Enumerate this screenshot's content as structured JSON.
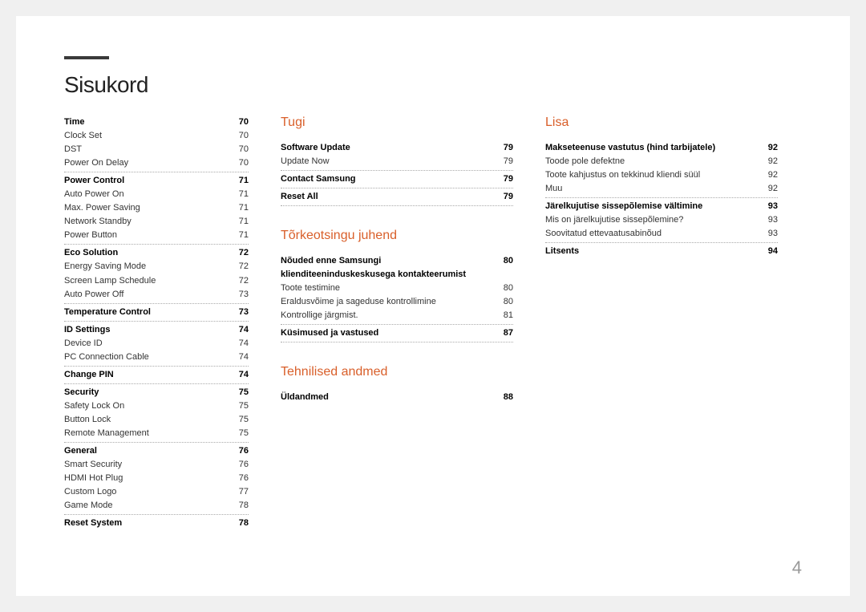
{
  "title": "Sisukord",
  "page_number": "4",
  "col1_groups": [
    [
      {
        "label": "Time",
        "page": "70",
        "bold": true
      },
      {
        "label": "Clock Set",
        "page": "70"
      },
      {
        "label": "DST",
        "page": "70"
      },
      {
        "label": "Power On Delay",
        "page": "70"
      }
    ],
    [
      {
        "label": "Power Control",
        "page": "71",
        "bold": true
      },
      {
        "label": "Auto Power On",
        "page": "71"
      },
      {
        "label": "Max. Power Saving",
        "page": "71"
      },
      {
        "label": "Network Standby",
        "page": "71"
      },
      {
        "label": "Power Button",
        "page": "71"
      }
    ],
    [
      {
        "label": "Eco Solution",
        "page": "72",
        "bold": true
      },
      {
        "label": "Energy Saving Mode",
        "page": "72"
      },
      {
        "label": "Screen Lamp Schedule",
        "page": "72"
      },
      {
        "label": "Auto Power Off",
        "page": "73"
      }
    ],
    [
      {
        "label": "Temperature Control",
        "page": "73",
        "bold": true
      }
    ],
    [
      {
        "label": "ID Settings",
        "page": "74",
        "bold": true
      },
      {
        "label": "Device ID",
        "page": "74"
      },
      {
        "label": "PC Connection Cable",
        "page": "74"
      }
    ],
    [
      {
        "label": "Change PIN",
        "page": "74",
        "bold": true
      }
    ],
    [
      {
        "label": "Security",
        "page": "75",
        "bold": true
      },
      {
        "label": "Safety Lock On",
        "page": "75"
      },
      {
        "label": "Button Lock",
        "page": "75"
      },
      {
        "label": "Remote Management",
        "page": "75"
      }
    ],
    [
      {
        "label": "General",
        "page": "76",
        "bold": true
      },
      {
        "label": "Smart Security",
        "page": "76"
      },
      {
        "label": "HDMI Hot Plug",
        "page": "76"
      },
      {
        "label": "Custom Logo",
        "page": "77"
      },
      {
        "label": "Game Mode",
        "page": "78"
      }
    ],
    [
      {
        "label": "Reset System",
        "page": "78",
        "bold": true
      }
    ]
  ],
  "col2_sections": [
    {
      "title": "Tugi",
      "groups": [
        [
          {
            "label": "Software Update",
            "page": "79",
            "bold": true
          },
          {
            "label": "Update Now",
            "page": "79"
          }
        ],
        [
          {
            "label": "Contact Samsung",
            "page": "79",
            "bold": true
          }
        ],
        [
          {
            "label": "Reset All",
            "page": "79",
            "bold": true
          }
        ]
      ]
    },
    {
      "title": "Tõrkeotsingu juhend",
      "groups": [
        [
          {
            "label": "Nõuded enne Samsungi klienditeeninduskeskusega kontakteerumist",
            "page": "80",
            "bold": true
          },
          {
            "label": "Toote testimine",
            "page": "80"
          },
          {
            "label": "Eraldusvõime ja sageduse kontrollimine",
            "page": "80"
          },
          {
            "label": "Kontrollige järgmist.",
            "page": "81"
          }
        ],
        [
          {
            "label": "Küsimused ja vastused",
            "page": "87",
            "bold": true
          }
        ]
      ]
    },
    {
      "title": "Tehnilised andmed",
      "groups": [
        [
          {
            "label": "Üldandmed",
            "page": "88",
            "bold": true
          }
        ]
      ]
    }
  ],
  "col3_sections": [
    {
      "title": "Lisa",
      "groups": [
        [
          {
            "label": "Makseteenuse vastutus (hind tarbijatele)",
            "page": "92",
            "bold": true
          },
          {
            "label": "Toode pole defektne",
            "page": "92"
          },
          {
            "label": "Toote kahjustus on tekkinud kliendi süül",
            "page": "92"
          },
          {
            "label": "Muu",
            "page": "92"
          }
        ],
        [
          {
            "label": "Järelkujutise sissepõlemise vältimine",
            "page": "93",
            "bold": true
          },
          {
            "label": "Mis on järelkujutise sissepõlemine?",
            "page": "93"
          },
          {
            "label": "Soovitatud ettevaatusabinõud",
            "page": "93"
          }
        ],
        [
          {
            "label": "Litsents",
            "page": "94",
            "bold": true
          }
        ]
      ]
    }
  ]
}
